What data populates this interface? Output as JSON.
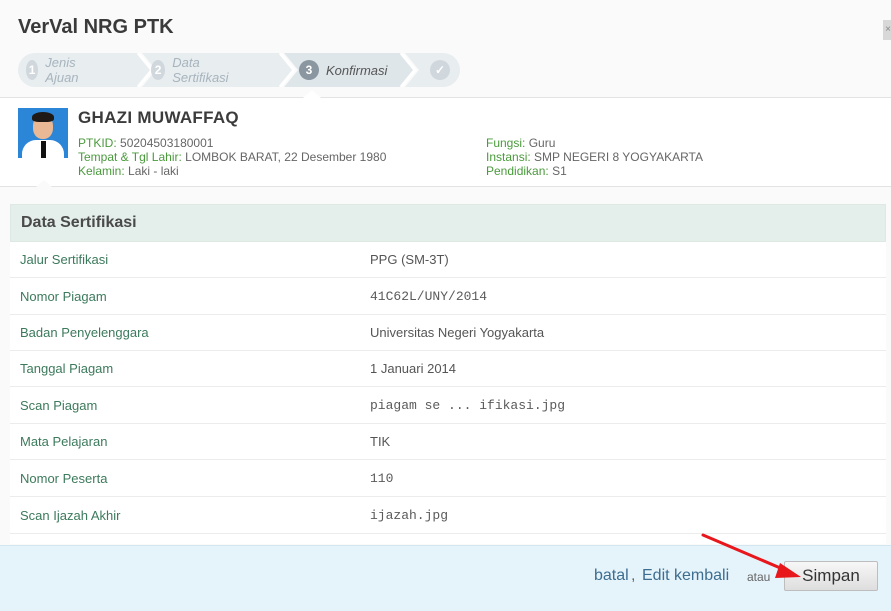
{
  "app": {
    "title": "VerVal NRG PTK"
  },
  "wizard": {
    "steps": [
      {
        "num": "1",
        "label": "Jenis Ajuan"
      },
      {
        "num": "2",
        "label": "Data Sertifikasi"
      },
      {
        "num": "3",
        "label": "Konfirmasi"
      }
    ],
    "active_index": 2
  },
  "profile": {
    "name": "GHAZI MUWAFFAQ",
    "left": [
      {
        "label": "PTKID:",
        "value": "50204503180001"
      },
      {
        "label": "Tempat & Tgl Lahir:",
        "value": "LOMBOK BARAT, 22 Desember 1980"
      },
      {
        "label": "Kelamin:",
        "value": "Laki - laki"
      }
    ],
    "right": [
      {
        "label": "Fungsi:",
        "value": "Guru"
      },
      {
        "label": "Instansi:",
        "value": "SMP NEGERI 8 YOGYAKARTA"
      },
      {
        "label": "Pendidikan:",
        "value": "S1"
      }
    ]
  },
  "section": {
    "title": "Data Sertifikasi",
    "rows": [
      {
        "key": "Jalur Sertifikasi",
        "value": "PPG (SM-3T)"
      },
      {
        "key": "Nomor Piagam",
        "value": "41C62L/UNY/2014"
      },
      {
        "key": "Badan Penyelenggara",
        "value": "Universitas Negeri Yogyakarta"
      },
      {
        "key": "Tanggal Piagam",
        "value": "1 Januari 2014"
      },
      {
        "key": "Scan Piagam",
        "value": "piagam se ... ifikasi.jpg"
      },
      {
        "key": "Mata Pelajaran",
        "value": "TIK"
      },
      {
        "key": "Nomor Peserta",
        "value": "110"
      },
      {
        "key": "Scan Ijazah Akhir",
        "value": "ijazah.jpg"
      }
    ]
  },
  "footer": {
    "cancel_label": "batal",
    "separator": ",",
    "edit_label": "Edit kembali",
    "or_label": "atau",
    "save_label": "Simpan"
  },
  "colors": {
    "label_green": "#4a9a3c",
    "key_teal": "#3c7a5c",
    "link_blue": "#3d6d8f",
    "footer_bg": "#e5f3fb",
    "arrow_red": "#e8171b"
  },
  "icons": {
    "close": "close-icon",
    "check": "check-icon",
    "arrow": "annotation-arrow"
  }
}
